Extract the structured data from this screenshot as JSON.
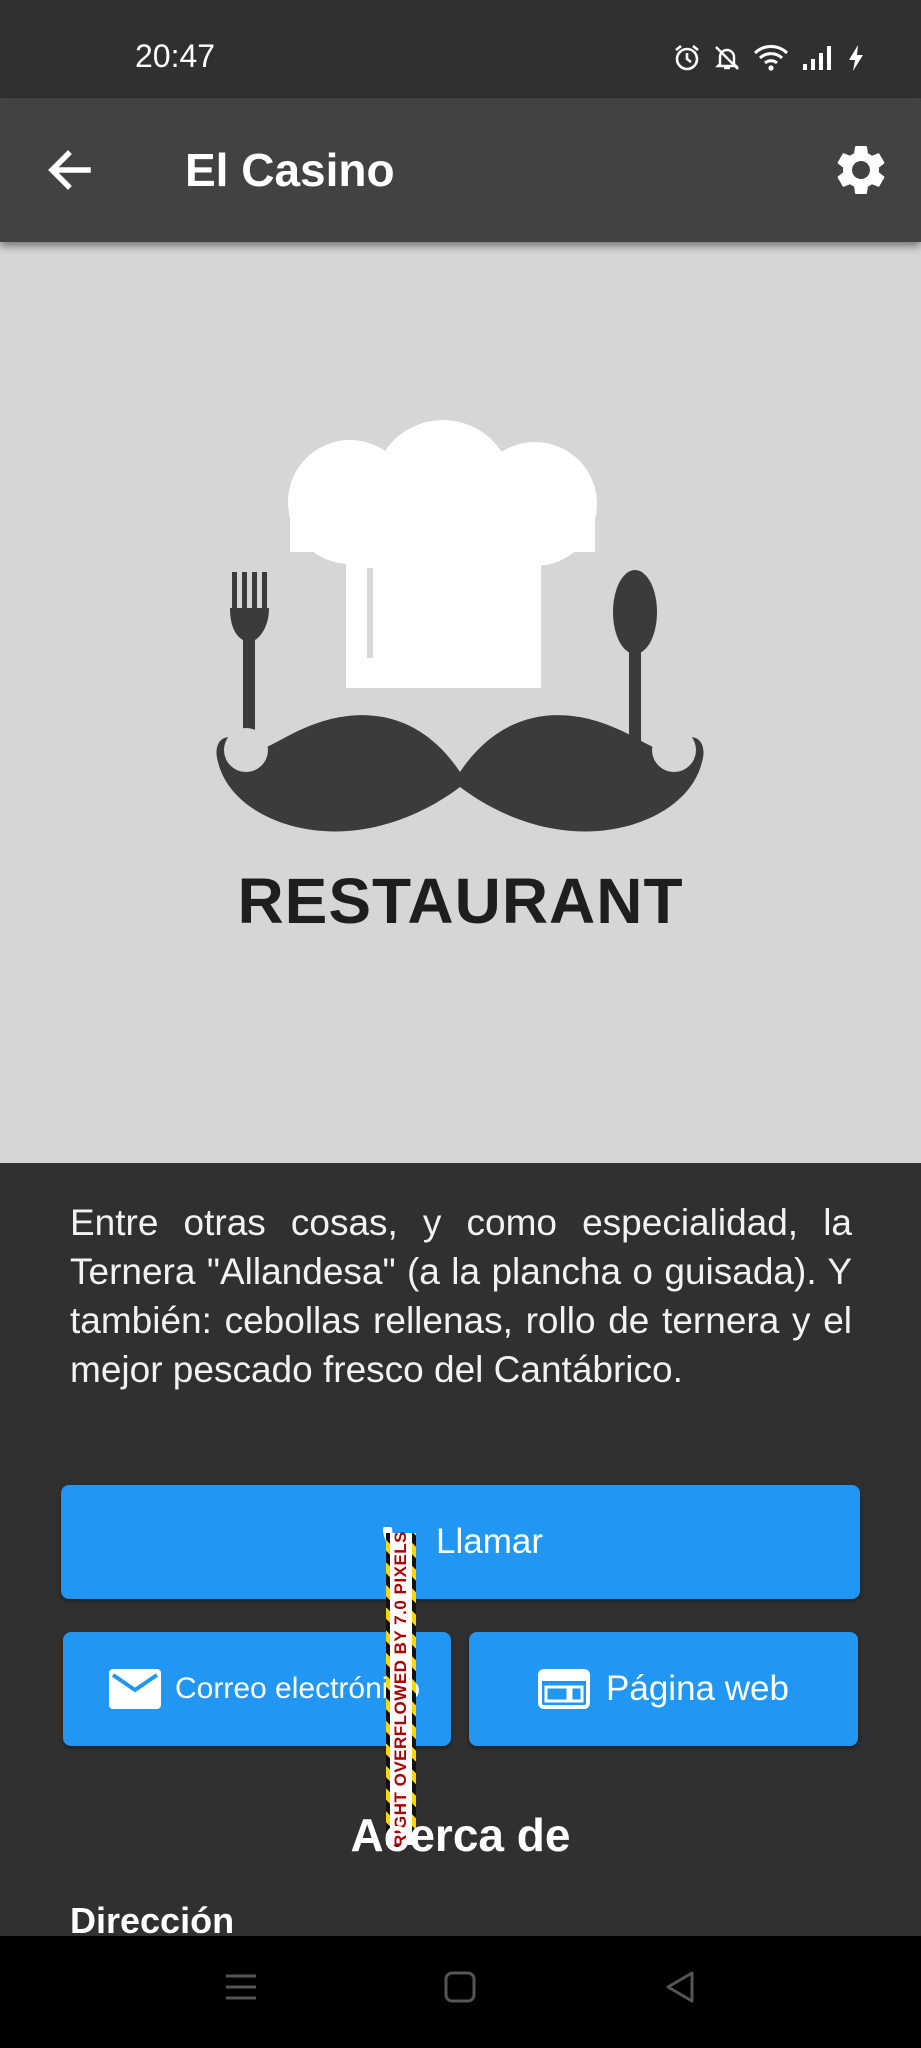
{
  "status_bar": {
    "time": "20:47",
    "icons": [
      "alarm-icon",
      "mute-notifications-icon",
      "wifi-icon",
      "signal-icon",
      "charging-icon"
    ]
  },
  "app_bar": {
    "title": "El Casino",
    "back_icon": "arrow-back-icon",
    "settings_icon": "gear-icon"
  },
  "hero": {
    "logo_text": "RESTAURANT"
  },
  "description": "Entre otras cosas, y como especialidad, la Ternera \"Allandesa\" (a la plancha o guisada). Y también: cebollas rellenas, rollo de ternera y el mejor pescado fresco del Cantábrico.",
  "actions": {
    "call_label": "Llamar",
    "email_label": "Correo electrónico",
    "web_label": "Página web"
  },
  "overflow_warning": "RIGHT OVERFLOWED BY 7.0 PIXELS",
  "about": {
    "title": "Acerca de",
    "address_heading": "Dirección"
  },
  "colors": {
    "accent": "#2196f3",
    "app_bar": "#424242",
    "background": "#303030",
    "hero_bg": "#d6d6d6"
  }
}
